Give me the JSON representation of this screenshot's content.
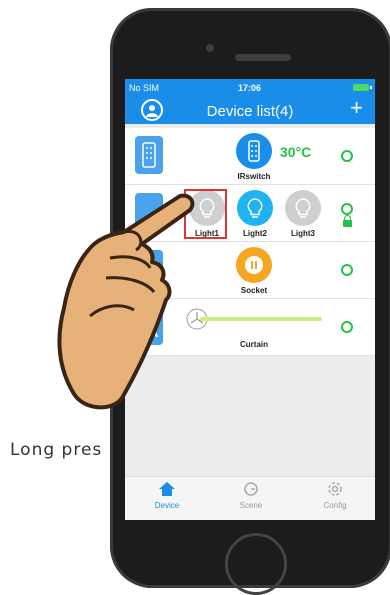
{
  "caption": "Long pres",
  "status": {
    "carrier": "No SIM",
    "time": "17:06"
  },
  "nav": {
    "title": "Device list(4)",
    "add_icon": "plus-icon",
    "avatar_icon": "user-icon"
  },
  "rows": {
    "ir": {
      "device_name": "IRswitch",
      "temperature": "30°C"
    },
    "light": {
      "devices": [
        {
          "name": "Light1",
          "state": "off"
        },
        {
          "name": "Light2",
          "state": "on"
        },
        {
          "name": "Light3",
          "state": "off"
        }
      ]
    },
    "socket": {
      "device_name": "Socket"
    },
    "curtain": {
      "device_name": "Curtain"
    }
  },
  "tabs": {
    "device": "Device",
    "scene": "Scene",
    "config": "Config"
  },
  "colors": {
    "accent": "#1a8de9",
    "online": "#24c244",
    "light_on": "#1fb4f0",
    "socket": "#f5a623",
    "highlight": "#e03434"
  }
}
